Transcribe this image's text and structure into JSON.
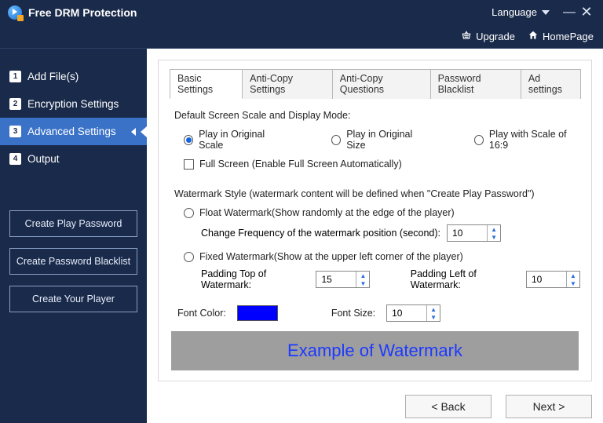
{
  "app": {
    "title": "Free DRM Protection"
  },
  "titlebar": {
    "language_label": "Language",
    "minimize": "—",
    "close": "✕"
  },
  "subbar": {
    "upgrade": "Upgrade",
    "homepage": "HomePage"
  },
  "sidebar": {
    "steps": [
      {
        "num": "1",
        "label": "Add File(s)"
      },
      {
        "num": "2",
        "label": "Encryption Settings"
      },
      {
        "num": "3",
        "label": "Advanced Settings"
      },
      {
        "num": "4",
        "label": "Output"
      }
    ],
    "active_index": 2,
    "buttons": {
      "create_play_password": "Create Play Password",
      "create_password_blacklist": "Create Password Blacklist",
      "create_your_player": "Create Your Player"
    }
  },
  "tabs": {
    "items": [
      "Basic Settings",
      "Anti-Copy Settings",
      "Anti-Copy Questions",
      "Password Blacklist",
      "Ad settings"
    ],
    "selected_index": 0
  },
  "basic": {
    "scale_title": "Default Screen Scale and Display Mode:",
    "opt_original_scale": "Play in Original Scale",
    "opt_original_size": "Play in Original Size",
    "opt_scale_169": "Play with Scale of 16:9",
    "opt_fullscreen": "Full Screen (Enable Full Screen Automatically)",
    "scale_selected": "original_scale",
    "wm_title": "Watermark Style (watermark content will be defined when \"Create Play Password\")",
    "wm_float": "Float Watermark(Show randomly at the edge of the player)",
    "wm_float_freq_label": "Change Frequency of the watermark position (second):",
    "wm_float_freq_value": "10",
    "wm_fixed": "Fixed Watermark(Show at the upper left corner of the player)",
    "wm_pad_top_label": "Padding Top of Watermark:",
    "wm_pad_top_value": "15",
    "wm_pad_left_label": "Padding Left of Watermark:",
    "wm_pad_left_value": "10",
    "font_color_label": "Font Color:",
    "font_color_value": "#0000ff",
    "font_size_label": "Font Size:",
    "font_size_value": "10",
    "preview_text": "Example of Watermark"
  },
  "footer": {
    "back": "<  Back",
    "next": "Next  >"
  }
}
